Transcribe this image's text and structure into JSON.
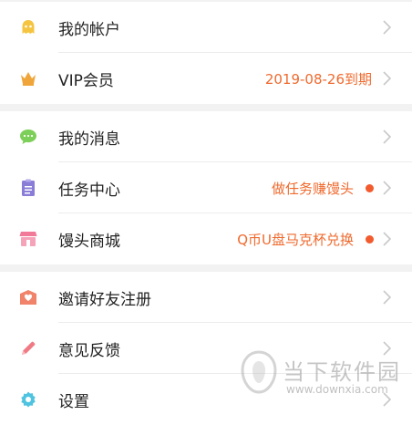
{
  "groups": [
    {
      "items": [
        {
          "label": "我的帐户",
          "icon": "ghost-avatar-icon",
          "icon_color": "#f5c542"
        },
        {
          "label": "VIP会员",
          "icon": "crown-icon",
          "icon_color": "#f0a53a",
          "value": "2019-08-26到期"
        }
      ]
    },
    {
      "items": [
        {
          "label": "我的消息",
          "icon": "chat-bubble-icon",
          "icon_color": "#7ccf58"
        },
        {
          "label": "任务中心",
          "icon": "clipboard-icon",
          "icon_color": "#8a7dd8",
          "value": "做任务赚馒头",
          "dot": true
        },
        {
          "label": "馒头商城",
          "icon": "store-icon",
          "icon_color": "#f07a98",
          "value": "Q币U盘马克杯兑换",
          "dot": true
        }
      ]
    },
    {
      "items": [
        {
          "label": "邀请好友注册",
          "icon": "envelope-heart-icon",
          "icon_color": "#f0836a"
        },
        {
          "label": "意见反馈",
          "icon": "pencil-icon",
          "icon_color": "#f07a84"
        },
        {
          "label": "设置",
          "icon": "gear-icon",
          "icon_color": "#4fc3e0"
        }
      ]
    }
  ],
  "colors": {
    "accent": "#ef6a2e",
    "dot": "#f25b2e",
    "background": "#f2f2f2"
  },
  "watermark": {
    "text": "当下软件园",
    "url": "www.downxia.com"
  }
}
